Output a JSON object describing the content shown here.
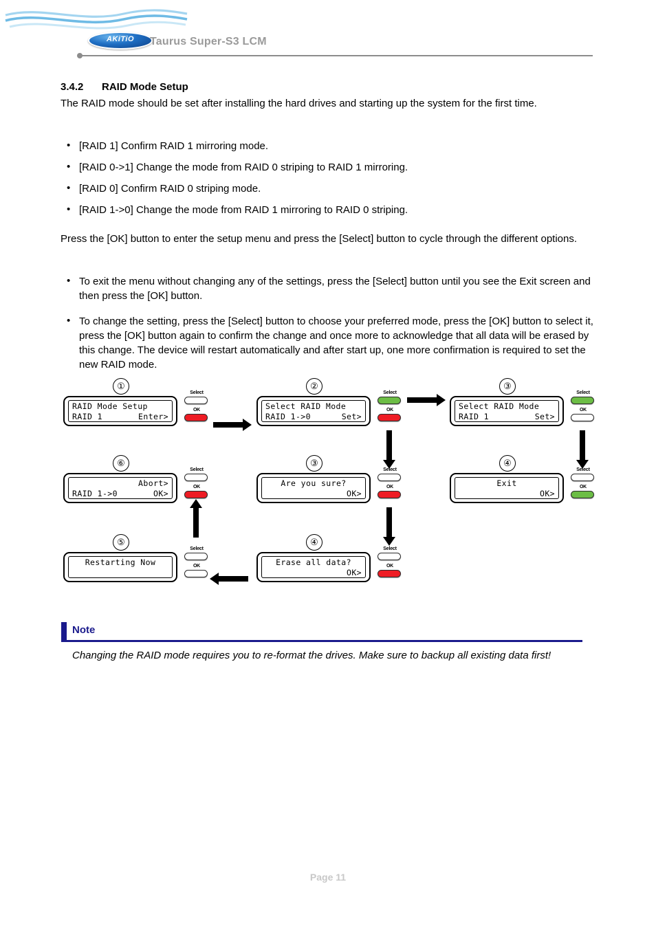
{
  "header": {
    "logo_text": "AKiTiO",
    "product_title": "Taurus Super-S3 LCM"
  },
  "section": {
    "number": "3.4.2",
    "title": "RAID Mode Setup",
    "intro": "The RAID mode should be set after installing the hard drives and starting up the system for the first time."
  },
  "mode_bullets": [
    "[RAID 1] Confirm RAID 1 mirroring mode.",
    "[RAID 0->1] Change the mode from RAID 0 striping to RAID 1 mirroring.",
    "[RAID 0] Confirm RAID 0 striping mode.",
    "[RAID 1->0] Change the mode from RAID 1 mirroring to RAID 0 striping."
  ],
  "instructions": {
    "lead": "Press the [OK] button to enter the setup menu and press the [Select] button to cycle through the different options.",
    "bullets": [
      "To exit the menu without changing any of the settings, press the [Select] button until you see the Exit screen and then press the [OK] button.",
      "To change the setting, press the [Select] button to choose your preferred mode, press the [OK] button to select it, press the [OK] button again to confirm the change and once more to acknowledge that all data will be erased by this change. The device will restart automatically and after start up, one more confirmation is required to set the new RAID mode."
    ]
  },
  "diagram": {
    "button_labels": {
      "select": "Select",
      "ok": "OK"
    },
    "steps": [
      {
        "id": "step-r1c1",
        "number": "①",
        "line1": "RAID Mode Setup",
        "line2_left": "RAID 1",
        "line2_right": "Enter>",
        "align": "split",
        "select_state": "white",
        "ok_state": "red"
      },
      {
        "id": "step-r1c2",
        "number": "②",
        "line1": "Select RAID Mode",
        "line2_left": "RAID 1->0",
        "line2_right": "Set>",
        "align": "split",
        "select_state": "green",
        "ok_state": "red"
      },
      {
        "id": "step-r1c3",
        "number": "③",
        "line1": "Select RAID Mode",
        "line2_left": "RAID 1",
        "line2_right": "Set>",
        "align": "split",
        "select_state": "green",
        "ok_state": "white"
      },
      {
        "id": "step-r2c1",
        "number": "⑥",
        "line1": "Abort>",
        "line2_left": "RAID 1->0",
        "line2_right": "OK>",
        "align": "line1right",
        "select_state": "white",
        "ok_state": "red"
      },
      {
        "id": "step-r2c2",
        "number": "③",
        "line1": "Are you sure?",
        "line2_left": "",
        "line2_right": "OK>",
        "align": "line1center",
        "select_state": "white",
        "ok_state": "red"
      },
      {
        "id": "step-r2c3",
        "number": "④",
        "line1": "Exit",
        "line2_left": "",
        "line2_right": "OK>",
        "align": "line1center",
        "select_state": "white",
        "ok_state": "green"
      },
      {
        "id": "step-r3c1",
        "number": "⑤",
        "line1": "Restarting Now",
        "line2_left": "",
        "line2_right": "",
        "align": "line1center",
        "select_state": "white",
        "ok_state": "white"
      },
      {
        "id": "step-r3c2",
        "number": "④",
        "line1": "Erase all data?",
        "line2_left": "",
        "line2_right": "OK>",
        "align": "line1center",
        "select_state": "white",
        "ok_state": "red"
      }
    ]
  },
  "note": {
    "title": "Note",
    "body": "Changing the RAID mode requires you to re-format the drives. Make sure to backup all existing data first!"
  },
  "footer": {
    "page": "Page 11"
  },
  "colors": {
    "accent_note": "#1a1a8c",
    "led_red": "#ee1c24",
    "led_green": "#6cbd45",
    "header_gray": "#9a9a9a",
    "footer_gray": "#c8c8c8"
  }
}
